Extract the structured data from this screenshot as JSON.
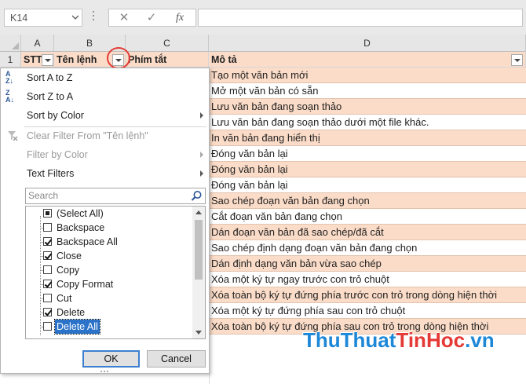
{
  "formula_bar": {
    "name_box": "K14",
    "cancel_icon": "✕",
    "enter_icon": "✓",
    "fx_icon": "fx",
    "formula": ""
  },
  "columns": [
    "A",
    "B",
    "C",
    "D"
  ],
  "rows": [
    "1"
  ],
  "table": {
    "headers": [
      "STT",
      "Tên lệnh",
      "Phím tắt",
      "Mô tả"
    ],
    "descriptions": [
      "Tạo một văn bản mới",
      "Mở một văn bản có sẵn",
      "Lưu văn bản đang soạn thảo",
      "Lưu văn bản đang soạn thảo dưới một file khác.",
      "In văn bản đang hiển thị",
      "Đóng văn bản lại",
      "Đóng văn bản lại",
      "Đóng văn bản lại",
      "Sao chép đoạn văn bản đang chọn",
      "Cắt đoạn văn bản đang chọn",
      "Dán đoạn văn bản đã sao chép/đã cắt",
      "Sao chép định dạng đoạn văn bản đang chọn",
      "Dán định dạng văn bản vừa sao chép",
      "Xóa một ký tự ngay trước con trỏ chuột",
      "Xóa toàn bộ ký tự đứng phía trước con trỏ trong dòng hiện thời",
      "Xóa một ký tự đứng phía sau con trỏ chuột",
      "Xóa toàn bộ ký tự đứng phía sau con trỏ trong dòng hiện thời"
    ]
  },
  "filter_menu": {
    "sort_a_z": "Sort A to Z",
    "sort_z_a": "Sort Z to A",
    "sort_by_color": "Sort by Color",
    "clear_filter": "Clear Filter From \"Tên lệnh\"",
    "filter_by_color": "Filter by Color",
    "text_filters": "Text Filters",
    "search_placeholder": "Search",
    "items": [
      {
        "label": "(Select All)",
        "state": "partial"
      },
      {
        "label": "Backspace",
        "state": "unchecked"
      },
      {
        "label": "Backspace All",
        "state": "checked"
      },
      {
        "label": "Close",
        "state": "checked"
      },
      {
        "label": "Copy",
        "state": "unchecked"
      },
      {
        "label": "Copy Format",
        "state": "checked"
      },
      {
        "label": "Cut",
        "state": "unchecked"
      },
      {
        "label": "Delete",
        "state": "checked"
      },
      {
        "label": "Delete All",
        "state": "unchecked",
        "selected": true
      }
    ],
    "ok": "OK",
    "cancel": "Cancel"
  },
  "watermark": {
    "part1": "ThuThuat",
    "part2": "TinHoc",
    "part3": ".vn"
  },
  "colors": {
    "header_fill": "#fbdcc8",
    "accent_blue": "#2b73c9",
    "highlight_red": "#e53935"
  }
}
